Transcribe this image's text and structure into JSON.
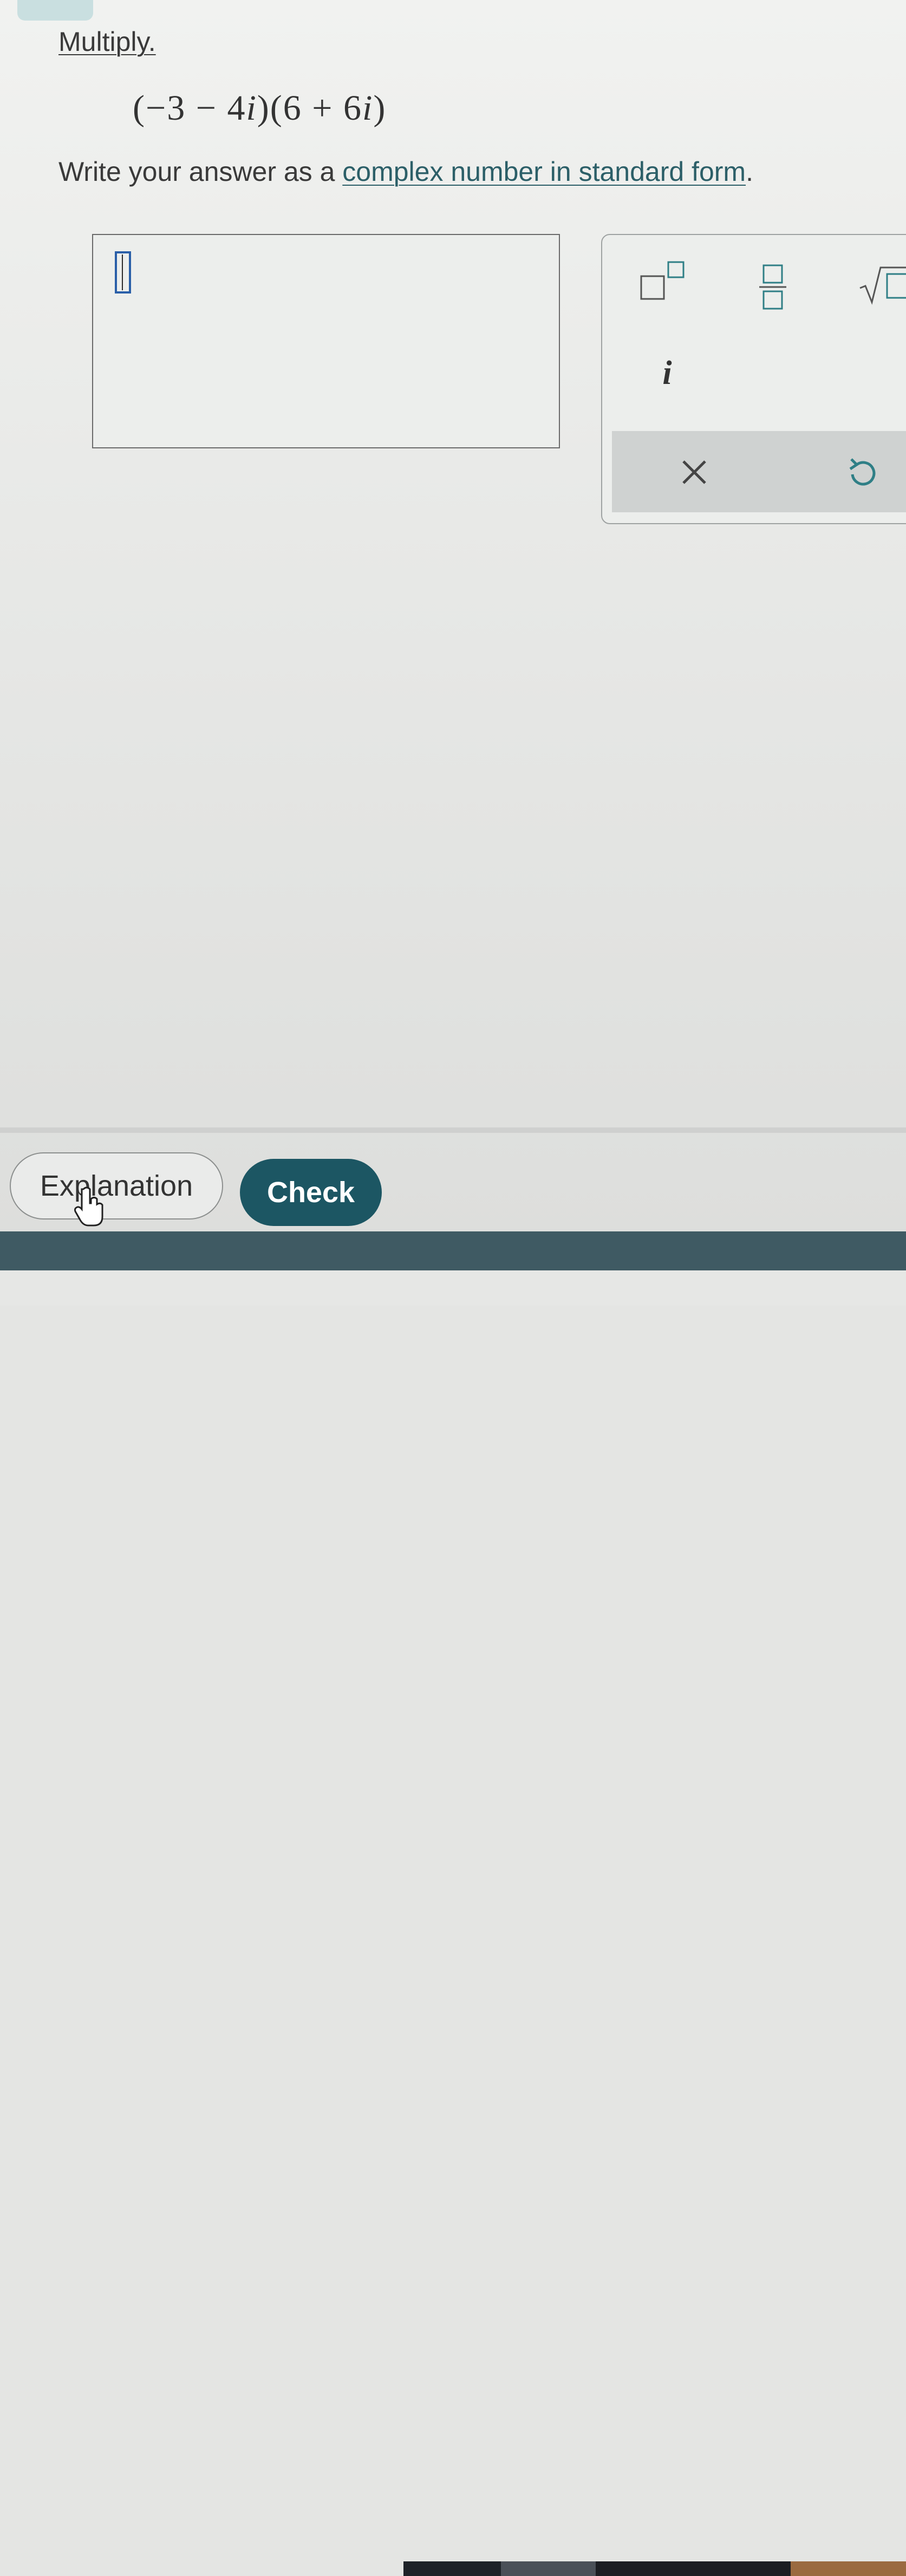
{
  "problem": {
    "prompt": "Multiply.",
    "expression": {
      "open1": "(",
      "a": "−3",
      "op1": "−",
      "b_coef": "4",
      "b_unit": "i",
      "close1": ")",
      "open2": "(",
      "c": "6",
      "op2": "+",
      "d_coef": "6",
      "d_unit": "i",
      "close2": ")"
    },
    "instruction_prefix": "Write your answer as a ",
    "instruction_link": "complex number in standard form",
    "instruction_suffix": "."
  },
  "answer_input": {
    "value": ""
  },
  "keypad": {
    "keys": [
      {
        "name": "exponent",
        "icon": "superscript-box-icon"
      },
      {
        "name": "fraction",
        "icon": "fraction-icon"
      },
      {
        "name": "square-root",
        "icon": "sqrt-icon"
      },
      {
        "name": "imaginary-unit",
        "label": "i"
      },
      {
        "name": "clear",
        "icon": "close-icon"
      },
      {
        "name": "undo",
        "icon": "undo-icon"
      }
    ],
    "i_label": "i"
  },
  "footer": {
    "explanation_label": "Explanation",
    "check_label": "Check"
  },
  "colors": {
    "accent": "#1c5663",
    "link": "#2c5f68",
    "icon_teal": "#2f7f86",
    "cursor_blue": "#2a5fa8",
    "footer_bar": "#3f5a63"
  }
}
